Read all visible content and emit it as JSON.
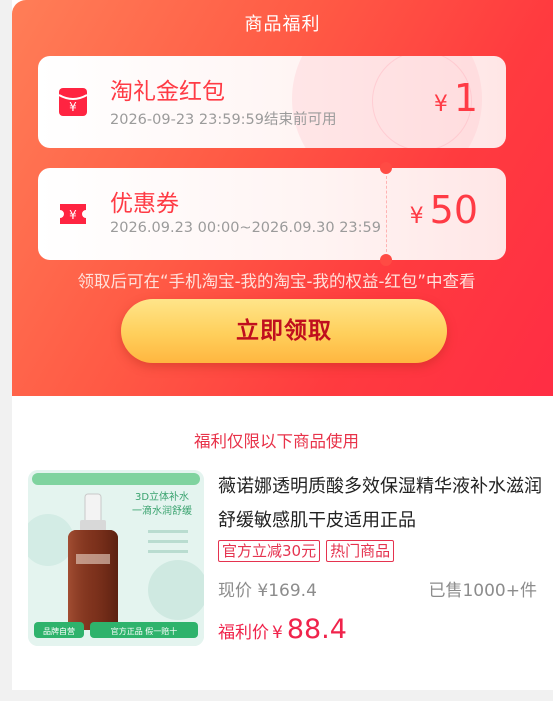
{
  "header": {
    "title": "商品福利"
  },
  "coupons": [
    {
      "name": "淘礼金红包",
      "validity": "2026-09-23 23:59:59结束前可用",
      "currency": "¥",
      "amount": "1",
      "icon": "red-packet-icon"
    },
    {
      "name": "优惠券",
      "validity": "2026.09.23 00:00~2026.09.30 23:59",
      "currency": "¥",
      "amount": "50",
      "icon": "coupon-ticket-icon"
    }
  ],
  "hint": "领取后可在“手机淘宝-我的淘宝-我的权益-红包”中查看",
  "claim_button": "立即领取",
  "limit_text": "福利仅限以下商品使用",
  "product": {
    "title": "薇诺娜透明质酸多效保湿精华液补水滋润舒缓敏感肌干皮适用正品",
    "tags": [
      "官方立减30元",
      "热门商品"
    ],
    "price_label": "现价",
    "price": "¥169.4",
    "sold": "已售1000+件",
    "promo_label": "福利价",
    "promo_currency": "¥",
    "promo_price": "88.4",
    "image_texts": {
      "headline1": "3D立体补水",
      "headline2": "一滴水润舒缓",
      "badge_left": "品牌自营",
      "badge_right": "官方正品 假一赔十"
    }
  },
  "colors": {
    "accent_red": "#ff3b45",
    "gradient_start": "#ff7e57",
    "gradient_end": "#ff2d44",
    "button_yellow": "#ffcf5b",
    "button_text": "#c00e1e",
    "promo_red": "#f0234b"
  }
}
